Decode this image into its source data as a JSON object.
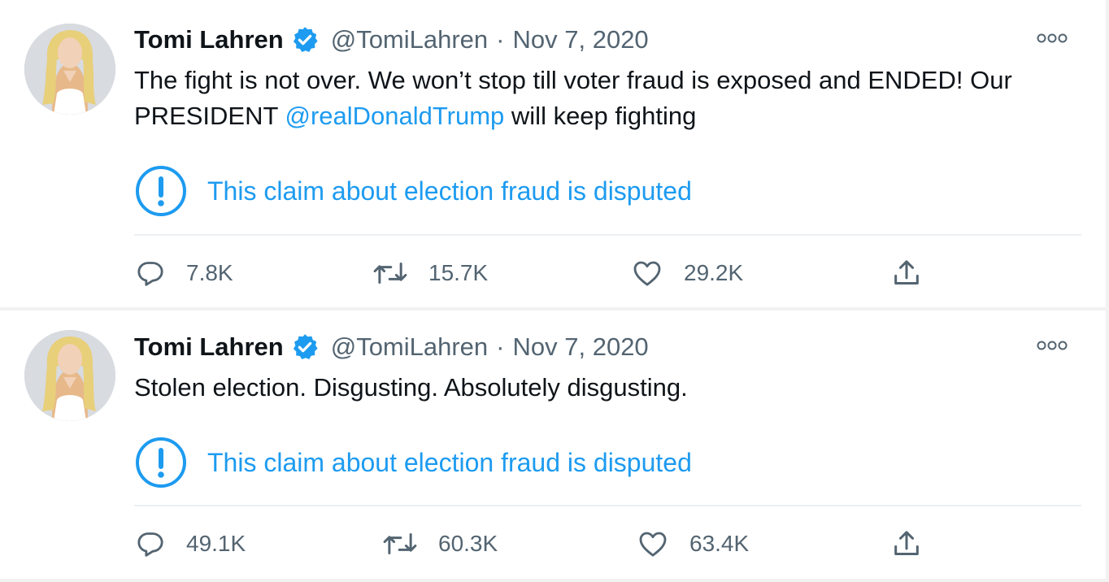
{
  "tweets": [
    {
      "author": {
        "name": "Tomi Lahren",
        "handle": "@TomiLahren",
        "verified": true
      },
      "separator": "·",
      "date": "Nov 7, 2020",
      "text_parts": [
        "The fight is not over. We won’t stop till voter fraud is exposed and ENDED! Our PRESIDENT ",
        "@realDonaldTrump",
        " will keep fighting"
      ],
      "notice": {
        "icon": "exclamation-circle-icon",
        "text": "This claim about election fraud is disputed"
      },
      "actions": {
        "replies": "7.8K",
        "retweets": "15.7K",
        "likes": "29.2K"
      }
    },
    {
      "author": {
        "name": "Tomi Lahren",
        "handle": "@TomiLahren",
        "verified": true
      },
      "separator": "·",
      "date": "Nov 7, 2020",
      "text": "Stolen election. Disgusting. Absolutely disgusting.",
      "notice": {
        "icon": "exclamation-circle-icon",
        "text": "This claim about election fraud is disputed"
      },
      "actions": {
        "replies": "49.1K",
        "retweets": "60.3K",
        "likes": "63.4K"
      }
    }
  ],
  "colors": {
    "link": "#1d9bf0",
    "secondary_text": "#536471",
    "primary_text": "#0f1419",
    "divider": "#eceff1"
  }
}
